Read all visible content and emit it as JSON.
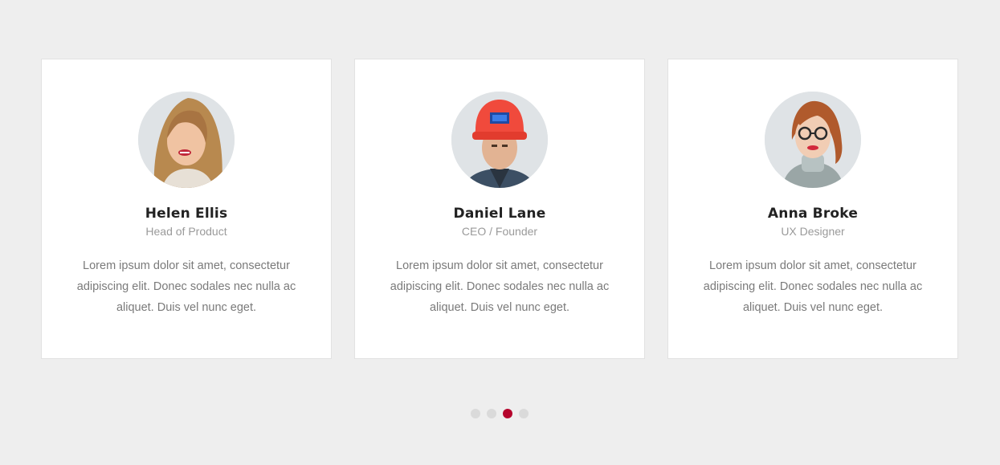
{
  "cards": [
    {
      "name": "Helen Ellis",
      "role": "Head of Product",
      "bio": "Lorem ipsum dolor sit amet, consectetur adipiscing elit. Donec sodales nec nulla ac aliquet. Duis vel nunc eget."
    },
    {
      "name": "Daniel Lane",
      "role": "CEO / Founder",
      "bio": "Lorem ipsum dolor sit amet, consectetur adipiscing elit. Donec sodales nec nulla ac aliquet. Duis vel nunc eget."
    },
    {
      "name": "Anna Broke",
      "role": "UX Designer",
      "bio": "Lorem ipsum dolor sit amet, consectetur adipiscing elit. Donec sodales nec nulla ac aliquet. Duis vel nunc eget."
    }
  ],
  "pagination": {
    "active_page": 3,
    "total_pages": 4
  },
  "colors": {
    "background": "#eeeeee",
    "card": "#ffffff",
    "accent": "#b5042c",
    "dot_inactive": "#dadada"
  }
}
